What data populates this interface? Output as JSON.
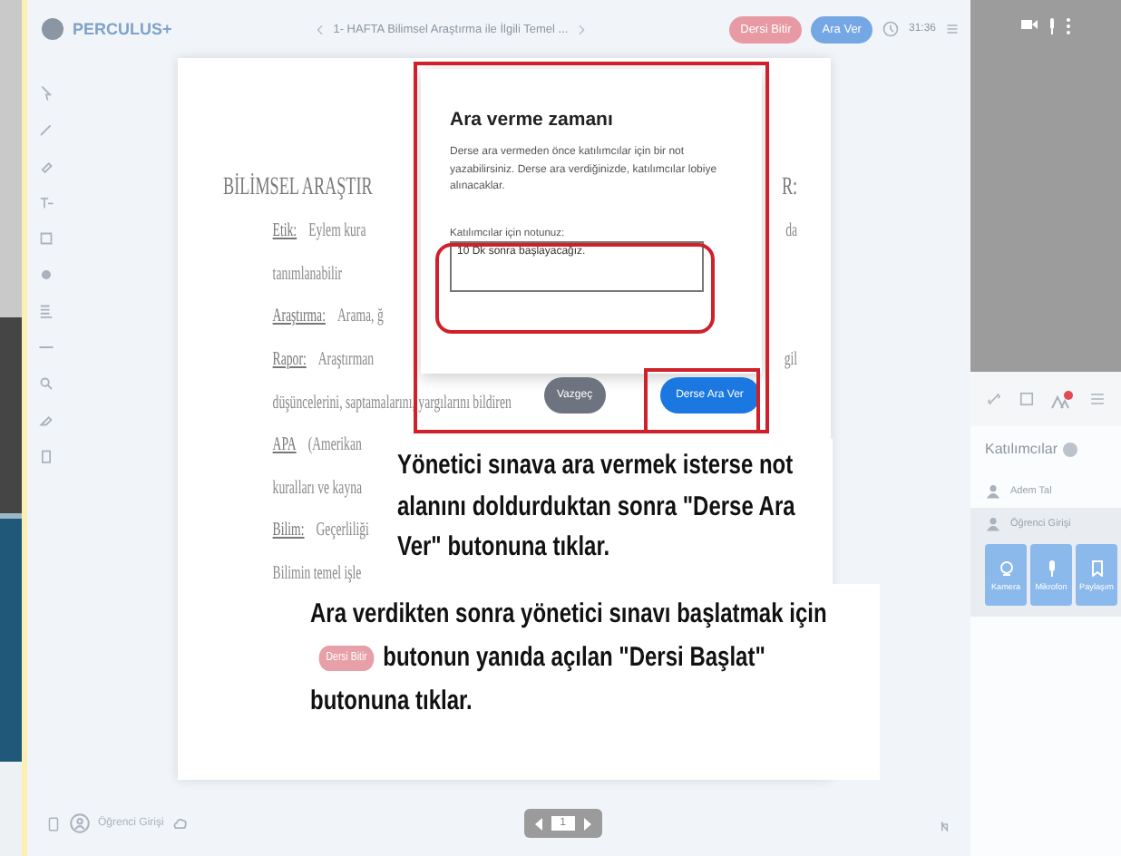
{
  "app": {
    "logo": "PERCULUS+"
  },
  "header": {
    "title": "1- HAFTA Bilimsel Araştırma ile İlgili Temel ...",
    "end_button": "Dersi Bitir",
    "break_button": "Ara Ver",
    "timer": "31:36"
  },
  "document": {
    "lines": [
      {
        "kind": "heading",
        "text": "BİLİMSEL ARAŞTIR",
        "tail": "R:"
      },
      {
        "kind": "body",
        "term": "Etik:",
        "text": "Eylem kura",
        "tail": "da"
      },
      {
        "kind": "body",
        "text": "tanımlanabilir"
      },
      {
        "kind": "body",
        "term": "Araştırma:",
        "text": "Arama, ğ"
      },
      {
        "kind": "body",
        "term": "Rapor:",
        "text": "Araştırman",
        "tail": "gil"
      },
      {
        "kind": "body",
        "text": "düşüncelerini, saptamalarını, yargılarını bildiren"
      },
      {
        "kind": "body",
        "term": "APA",
        "text": "(Amerikan"
      },
      {
        "kind": "body",
        "text": "kuralları ve kayna"
      },
      {
        "kind": "body",
        "term": "Bilim:",
        "text": "Geçerliliği"
      },
      {
        "kind": "body",
        "text": "Bilimin temel işle"
      }
    ]
  },
  "dialog": {
    "title": "Ara verme zamanı",
    "description": "Derse ara vermeden önce katılımcılar için bir not yazabilirsiniz. Derse ara verdiğinizde, katılımcılar lobiye alınacaklar.",
    "note_label": "Katılımcılar için notunuz:",
    "note_value": "10 Dk sonra başlayacağız.",
    "buttons": [
      {
        "label": "Vazgeç",
        "kind": "secondary"
      },
      {
        "label": "Derse Ara Ver",
        "kind": "primary"
      }
    ]
  },
  "annotations": [
    {
      "text": "Yönetici sınava ara vermek isterse not alanını doldurduktan sonra \"Derse Ara Ver\" butonuna tıklar."
    },
    {
      "before": "Ara verdikten sonra yönetici sınavı başlatmak için",
      "badge": "Dersi Bitir",
      "after": "butonun yanıda açılan \"Dersi Başlat\" butonuna tıklar."
    }
  ],
  "participants_panel": {
    "title": "Katılımcılar",
    "participants": [
      {
        "name": "Adem Tal",
        "selected": false
      },
      {
        "name": "Öğrenci Girişi",
        "selected": true
      }
    ],
    "media_buttons": [
      {
        "kind": "camera",
        "label": "Kamera"
      },
      {
        "kind": "mic",
        "label": "Mikrofon"
      },
      {
        "kind": "share",
        "label": "Paylaşım"
      }
    ]
  },
  "footer": {
    "user": "Öğrenci Girişi",
    "page": "1"
  }
}
